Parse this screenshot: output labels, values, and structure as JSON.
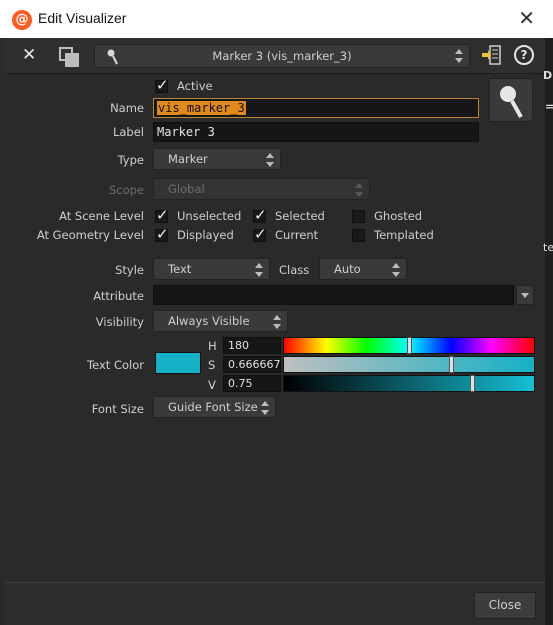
{
  "window": {
    "title": "Edit Visualizer"
  },
  "toolbar": {
    "visualizer_selected": "Marker 3 (vis_marker_3)"
  },
  "form": {
    "active_label": "Active",
    "active_checked": true,
    "name_label": "Name",
    "name_value": "vis_marker_3",
    "label_label": "Label",
    "label_value": "Marker 3",
    "type_label": "Type",
    "type_value": "Marker",
    "scope_label": "Scope",
    "scope_value": "Global",
    "scene_level": {
      "label": "At Scene Level",
      "options": [
        {
          "label": "Unselected",
          "checked": true
        },
        {
          "label": "Selected",
          "checked": true
        },
        {
          "label": "Ghosted",
          "checked": false
        }
      ]
    },
    "geometry_level": {
      "label": "At Geometry Level",
      "options": [
        {
          "label": "Displayed",
          "checked": true
        },
        {
          "label": "Current",
          "checked": true
        },
        {
          "label": "Templated",
          "checked": false
        }
      ]
    },
    "style_label": "Style",
    "style_value": "Text",
    "class_label": "Class",
    "class_value": "Auto",
    "attribute_label": "Attribute",
    "attribute_value": "",
    "visibility_label": "Visibility",
    "visibility_value": "Always Visible",
    "text_color": {
      "label": "Text Color",
      "swatch": "#16b1c6",
      "h_label": "H",
      "h_value": "180",
      "h_fraction": 0.5,
      "s_label": "S",
      "s_value": "0.666667",
      "s_fraction": 0.666667,
      "v_label": "V",
      "v_value": "0.75",
      "v_fraction": 0.75
    },
    "font_size_label": "Font Size",
    "font_size_value": "Guide Font Size"
  },
  "footer": {
    "close_label": "Close"
  },
  "backdrop": {
    "fragment_top": "D",
    "fragment_mid": "=",
    "fragment_low": "te"
  }
}
